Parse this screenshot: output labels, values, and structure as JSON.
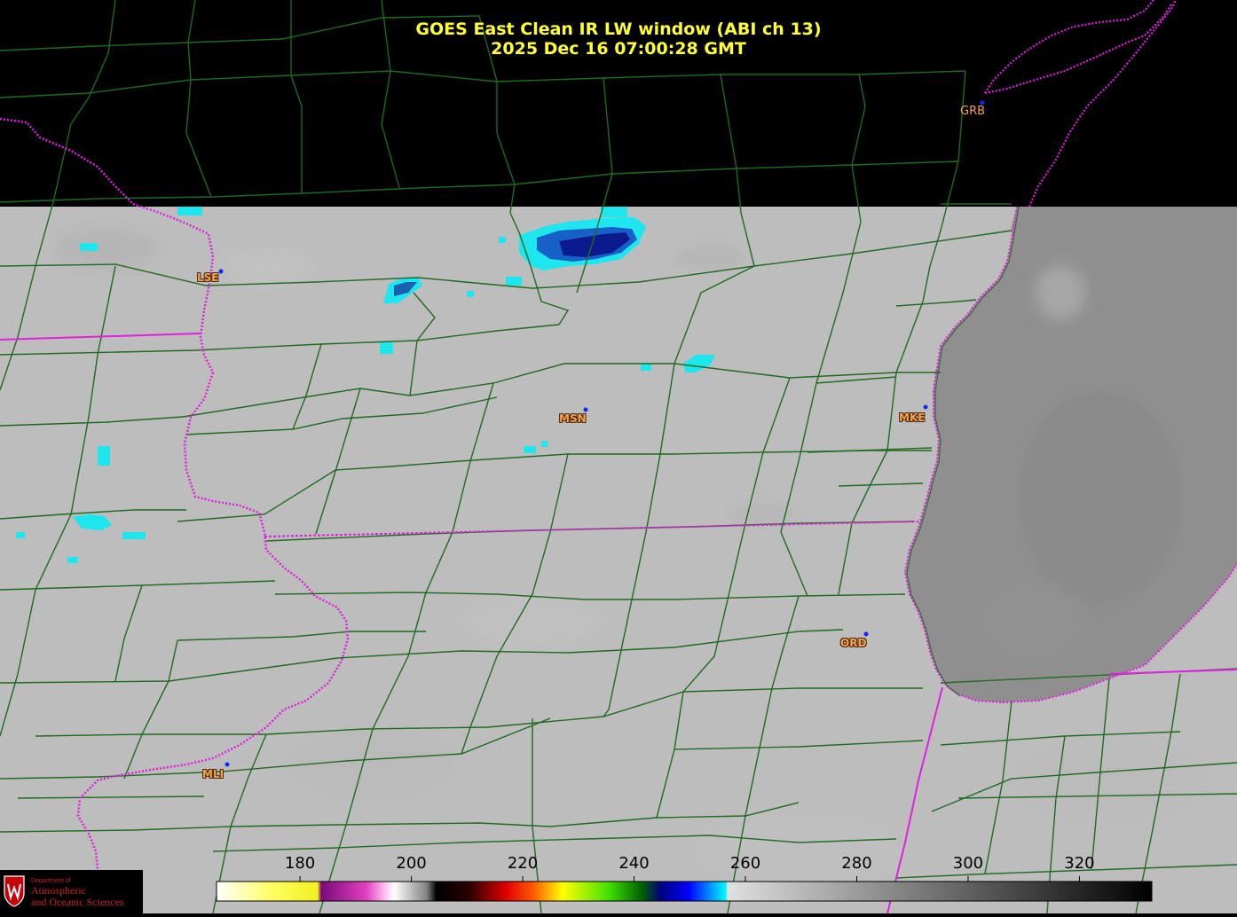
{
  "title": {
    "line1": "GOES East Clean IR LW window (ABI ch 13)",
    "line2": "2025 Dec 16  07:00:28 GMT"
  },
  "cities": [
    {
      "code": "LSE"
    },
    {
      "code": "MSN"
    },
    {
      "code": "MKE"
    },
    {
      "code": "GRB"
    },
    {
      "code": "ORD"
    },
    {
      "code": "MLI"
    }
  ],
  "colorbar": {
    "ticks": [
      "180",
      "200",
      "220",
      "240",
      "260",
      "280",
      "300",
      "320"
    ],
    "tick_values": [
      180,
      200,
      220,
      240,
      260,
      280,
      300,
      320
    ],
    "range": [
      165,
      333
    ]
  },
  "logo": {
    "line1": "Department of",
    "line2": "Atmospheric",
    "line3": "and Oceanic Sciences"
  },
  "colors": {
    "title": "#ffff33",
    "county_lines": "#1f6b1f",
    "state_lines": "#e020e0",
    "land": "#bdbdbd",
    "lake": "#8e8e8e",
    "city_label": "#f7a24a",
    "cloud_cyan": "#1ee6ee",
    "cloud_blue": "#0b1a8c"
  }
}
